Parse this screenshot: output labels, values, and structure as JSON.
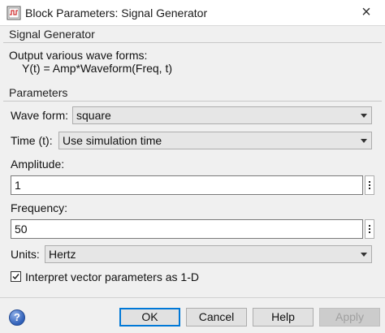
{
  "window": {
    "title": "Block Parameters: Signal Generator",
    "close_glyph": "×",
    "icon": "simulink-block-icon"
  },
  "description": {
    "group_title": "Signal Generator",
    "line1": "Output various wave forms:",
    "line2": "Y(t) = Amp*Waveform(Freq, t)"
  },
  "parameters": {
    "group_title": "Parameters",
    "wave_form": {
      "label": "Wave form:",
      "value": "square"
    },
    "time": {
      "label": "Time (t):",
      "value": "Use simulation time"
    },
    "amplitude": {
      "label": "Amplitude:",
      "value": "1"
    },
    "frequency": {
      "label": "Frequency:",
      "value": "50"
    },
    "units": {
      "label": "Units:",
      "value": "Hertz"
    },
    "interpret_vector": {
      "label": "Interpret vector parameters as 1-D",
      "checked": true
    }
  },
  "buttons": {
    "help_glyph": "?",
    "ok": "OK",
    "cancel": "Cancel",
    "help": "Help",
    "apply": "Apply"
  },
  "colors": {
    "accent": "#0078d7",
    "dialog_bg": "#f0f0f0"
  }
}
